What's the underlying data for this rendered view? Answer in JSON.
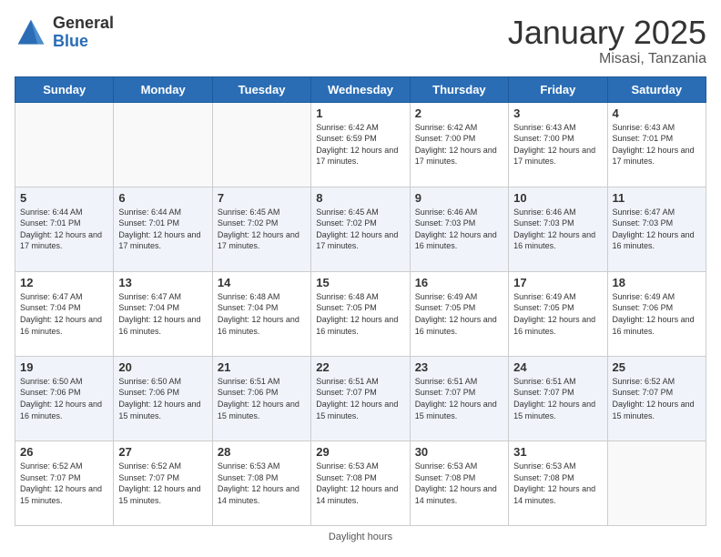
{
  "logo": {
    "general": "General",
    "blue": "Blue"
  },
  "title": "January 2025",
  "location": "Misasi, Tanzania",
  "days_of_week": [
    "Sunday",
    "Monday",
    "Tuesday",
    "Wednesday",
    "Thursday",
    "Friday",
    "Saturday"
  ],
  "footer": "Daylight hours",
  "weeks": [
    [
      {
        "day": "",
        "sunrise": "",
        "sunset": "",
        "daylight": ""
      },
      {
        "day": "",
        "sunrise": "",
        "sunset": "",
        "daylight": ""
      },
      {
        "day": "",
        "sunrise": "",
        "sunset": "",
        "daylight": ""
      },
      {
        "day": "1",
        "sunrise": "Sunrise: 6:42 AM",
        "sunset": "Sunset: 6:59 PM",
        "daylight": "Daylight: 12 hours and 17 minutes."
      },
      {
        "day": "2",
        "sunrise": "Sunrise: 6:42 AM",
        "sunset": "Sunset: 7:00 PM",
        "daylight": "Daylight: 12 hours and 17 minutes."
      },
      {
        "day": "3",
        "sunrise": "Sunrise: 6:43 AM",
        "sunset": "Sunset: 7:00 PM",
        "daylight": "Daylight: 12 hours and 17 minutes."
      },
      {
        "day": "4",
        "sunrise": "Sunrise: 6:43 AM",
        "sunset": "Sunset: 7:01 PM",
        "daylight": "Daylight: 12 hours and 17 minutes."
      }
    ],
    [
      {
        "day": "5",
        "sunrise": "Sunrise: 6:44 AM",
        "sunset": "Sunset: 7:01 PM",
        "daylight": "Daylight: 12 hours and 17 minutes."
      },
      {
        "day": "6",
        "sunrise": "Sunrise: 6:44 AM",
        "sunset": "Sunset: 7:01 PM",
        "daylight": "Daylight: 12 hours and 17 minutes."
      },
      {
        "day": "7",
        "sunrise": "Sunrise: 6:45 AM",
        "sunset": "Sunset: 7:02 PM",
        "daylight": "Daylight: 12 hours and 17 minutes."
      },
      {
        "day": "8",
        "sunrise": "Sunrise: 6:45 AM",
        "sunset": "Sunset: 7:02 PM",
        "daylight": "Daylight: 12 hours and 17 minutes."
      },
      {
        "day": "9",
        "sunrise": "Sunrise: 6:46 AM",
        "sunset": "Sunset: 7:03 PM",
        "daylight": "Daylight: 12 hours and 16 minutes."
      },
      {
        "day": "10",
        "sunrise": "Sunrise: 6:46 AM",
        "sunset": "Sunset: 7:03 PM",
        "daylight": "Daylight: 12 hours and 16 minutes."
      },
      {
        "day": "11",
        "sunrise": "Sunrise: 6:47 AM",
        "sunset": "Sunset: 7:03 PM",
        "daylight": "Daylight: 12 hours and 16 minutes."
      }
    ],
    [
      {
        "day": "12",
        "sunrise": "Sunrise: 6:47 AM",
        "sunset": "Sunset: 7:04 PM",
        "daylight": "Daylight: 12 hours and 16 minutes."
      },
      {
        "day": "13",
        "sunrise": "Sunrise: 6:47 AM",
        "sunset": "Sunset: 7:04 PM",
        "daylight": "Daylight: 12 hours and 16 minutes."
      },
      {
        "day": "14",
        "sunrise": "Sunrise: 6:48 AM",
        "sunset": "Sunset: 7:04 PM",
        "daylight": "Daylight: 12 hours and 16 minutes."
      },
      {
        "day": "15",
        "sunrise": "Sunrise: 6:48 AM",
        "sunset": "Sunset: 7:05 PM",
        "daylight": "Daylight: 12 hours and 16 minutes."
      },
      {
        "day": "16",
        "sunrise": "Sunrise: 6:49 AM",
        "sunset": "Sunset: 7:05 PM",
        "daylight": "Daylight: 12 hours and 16 minutes."
      },
      {
        "day": "17",
        "sunrise": "Sunrise: 6:49 AM",
        "sunset": "Sunset: 7:05 PM",
        "daylight": "Daylight: 12 hours and 16 minutes."
      },
      {
        "day": "18",
        "sunrise": "Sunrise: 6:49 AM",
        "sunset": "Sunset: 7:06 PM",
        "daylight": "Daylight: 12 hours and 16 minutes."
      }
    ],
    [
      {
        "day": "19",
        "sunrise": "Sunrise: 6:50 AM",
        "sunset": "Sunset: 7:06 PM",
        "daylight": "Daylight: 12 hours and 16 minutes."
      },
      {
        "day": "20",
        "sunrise": "Sunrise: 6:50 AM",
        "sunset": "Sunset: 7:06 PM",
        "daylight": "Daylight: 12 hours and 15 minutes."
      },
      {
        "day": "21",
        "sunrise": "Sunrise: 6:51 AM",
        "sunset": "Sunset: 7:06 PM",
        "daylight": "Daylight: 12 hours and 15 minutes."
      },
      {
        "day": "22",
        "sunrise": "Sunrise: 6:51 AM",
        "sunset": "Sunset: 7:07 PM",
        "daylight": "Daylight: 12 hours and 15 minutes."
      },
      {
        "day": "23",
        "sunrise": "Sunrise: 6:51 AM",
        "sunset": "Sunset: 7:07 PM",
        "daylight": "Daylight: 12 hours and 15 minutes."
      },
      {
        "day": "24",
        "sunrise": "Sunrise: 6:51 AM",
        "sunset": "Sunset: 7:07 PM",
        "daylight": "Daylight: 12 hours and 15 minutes."
      },
      {
        "day": "25",
        "sunrise": "Sunrise: 6:52 AM",
        "sunset": "Sunset: 7:07 PM",
        "daylight": "Daylight: 12 hours and 15 minutes."
      }
    ],
    [
      {
        "day": "26",
        "sunrise": "Sunrise: 6:52 AM",
        "sunset": "Sunset: 7:07 PM",
        "daylight": "Daylight: 12 hours and 15 minutes."
      },
      {
        "day": "27",
        "sunrise": "Sunrise: 6:52 AM",
        "sunset": "Sunset: 7:07 PM",
        "daylight": "Daylight: 12 hours and 15 minutes."
      },
      {
        "day": "28",
        "sunrise": "Sunrise: 6:53 AM",
        "sunset": "Sunset: 7:08 PM",
        "daylight": "Daylight: 12 hours and 14 minutes."
      },
      {
        "day": "29",
        "sunrise": "Sunrise: 6:53 AM",
        "sunset": "Sunset: 7:08 PM",
        "daylight": "Daylight: 12 hours and 14 minutes."
      },
      {
        "day": "30",
        "sunrise": "Sunrise: 6:53 AM",
        "sunset": "Sunset: 7:08 PM",
        "daylight": "Daylight: 12 hours and 14 minutes."
      },
      {
        "day": "31",
        "sunrise": "Sunrise: 6:53 AM",
        "sunset": "Sunset: 7:08 PM",
        "daylight": "Daylight: 12 hours and 14 minutes."
      },
      {
        "day": "",
        "sunrise": "",
        "sunset": "",
        "daylight": ""
      }
    ]
  ]
}
